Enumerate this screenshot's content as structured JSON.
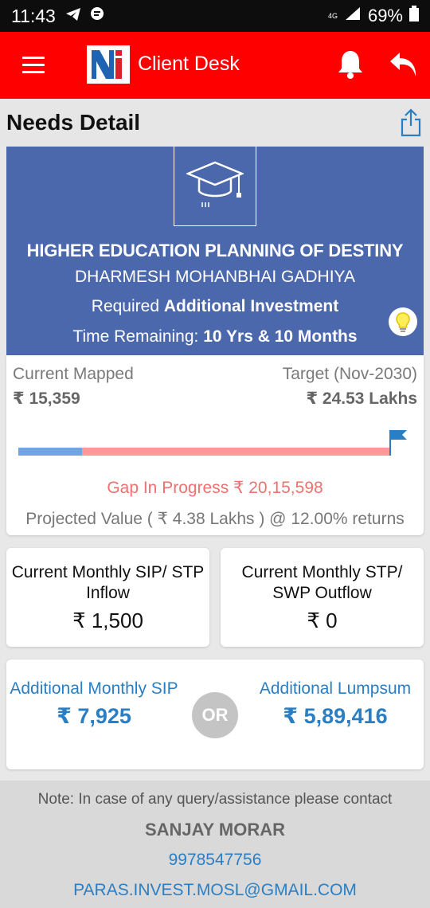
{
  "status_bar": {
    "time": "11:43",
    "network": "4G",
    "battery": "69%"
  },
  "app_bar": {
    "title": "Client Desk",
    "logo_text": "Nj"
  },
  "page": {
    "title": "Needs Detail"
  },
  "goal": {
    "title": "HIGHER EDUCATION PLANNING OF DESTINY",
    "client_name": "DHARMESH MOHANBHAI GADHIYA",
    "required_prefix": "Required",
    "required_value": "Additional Investment",
    "time_prefix": "Time Remaining:",
    "time_value": "10 Yrs & 10 Months"
  },
  "progress": {
    "current_label": "Current Mapped",
    "current_value": "₹ 15,359",
    "target_label": "Target (Nov-2030)",
    "target_value": "₹ 24.53 Lakhs",
    "fill_fraction": 0.17,
    "gap_text": "Gap In Progress ₹ 20,15,598",
    "projected_text": "Projected Value ( ₹ 4.38 Lakhs ) @ 12.00% returns"
  },
  "flows": {
    "sip_label": "Current Monthly SIP/ STP Inflow",
    "sip_value": "₹ 1,500",
    "stp_label": "Current Monthly STP/ SWP Outflow",
    "stp_value": "₹ 0"
  },
  "additional": {
    "sip_label": "Additional Monthly SIP",
    "sip_value": "₹ 7,925",
    "or_label": "OR",
    "lumpsum_label": "Additional Lumpsum",
    "lumpsum_value": "₹ 5,89,416"
  },
  "contact": {
    "note": "Note: In case of any query/assistance please contact",
    "name": "SANJAY MORAR",
    "phone": "9978547756",
    "email": "PARAS.INVEST.MOSL@GMAIL.COM"
  },
  "colors": {
    "app_bar": "#ff0000",
    "hero": "#4c68ac",
    "progress_fill": "#6ea4e8",
    "progress_track": "#ff9999",
    "link": "#2a7fc4"
  }
}
